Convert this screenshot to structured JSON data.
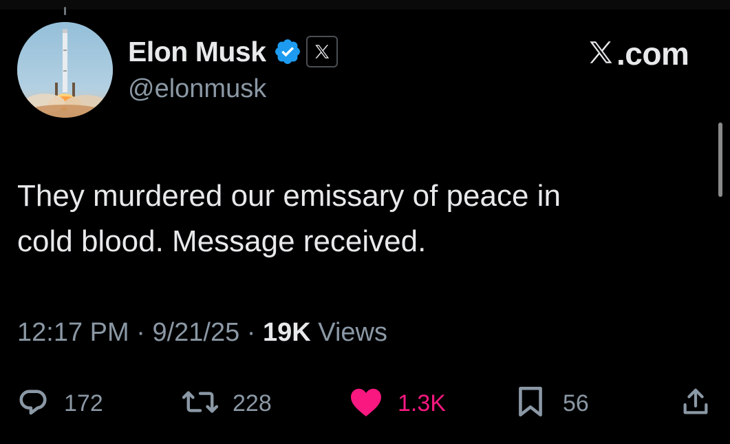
{
  "tweet": {
    "author": {
      "display_name": "Elon Musk",
      "handle": "@elonmusk"
    },
    "site_label": ".com",
    "text_lines": [
      "They murdered our emissary of peace in",
      "cold blood. Message received."
    ],
    "meta": {
      "time": "12:17 PM",
      "separator": "·",
      "date": "9/21/25",
      "views_count": "19K",
      "views_label": "Views"
    },
    "actions": {
      "replies": "172",
      "reposts": "228",
      "likes": "1.3K",
      "bookmarks": "56"
    }
  },
  "icons": {
    "reply": "reply-icon",
    "repost": "repost-icon",
    "like": "heart-icon",
    "bookmark": "bookmark-icon",
    "share": "share-icon",
    "verified": "verified-badge-icon",
    "affiliate": "x-logo-icon"
  },
  "colors": {
    "background": "#000000",
    "primary_text": "#e7e9ea",
    "secondary_text": "#8b98a5",
    "verified_blue": "#1d9bf0",
    "like_pink": "#f91880"
  }
}
